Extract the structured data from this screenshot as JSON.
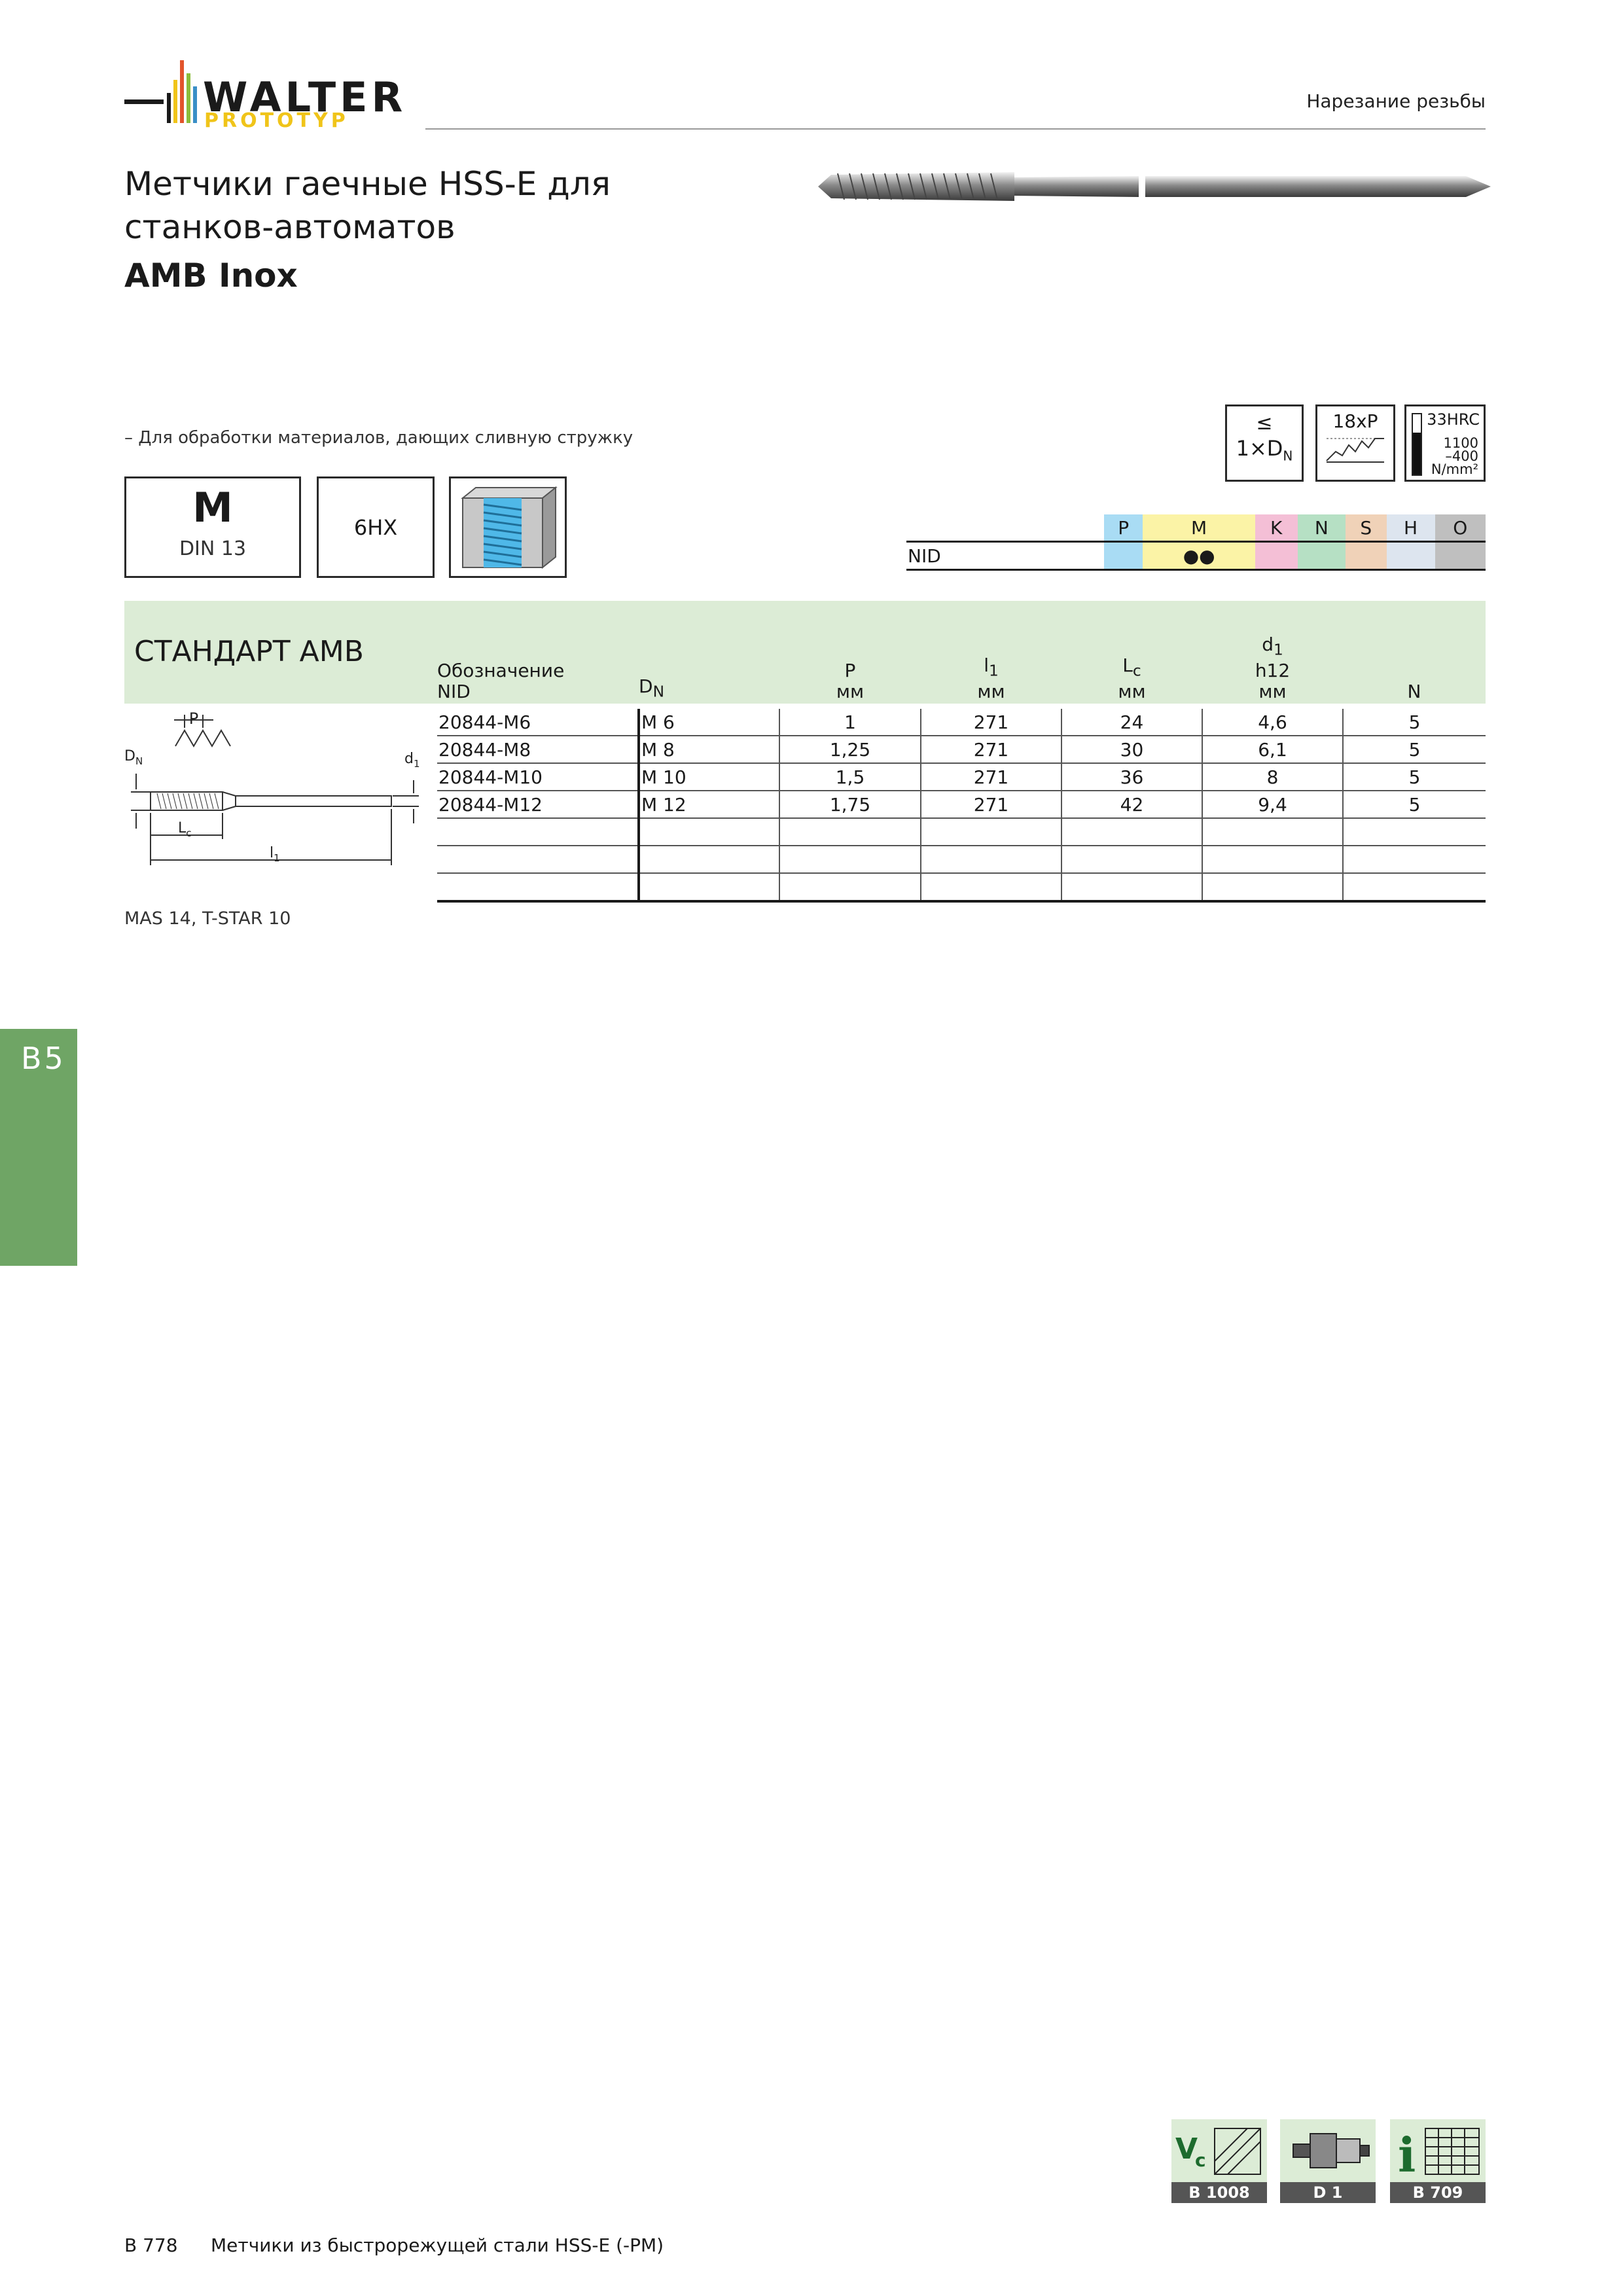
{
  "brand": {
    "name": "WALTER",
    "sub": "PROTOTYP",
    "stripe_colors": [
      "#1a1a1a",
      "#f0c419",
      "#e2542b",
      "#8bbd3b",
      "#3a8fc7"
    ],
    "accent_yellow": "#f0c419"
  },
  "header": {
    "section": "Нарезание резьбы"
  },
  "title": {
    "line1": "Метчики гаечные HSS-E для",
    "line2": "станков-автоматов",
    "product": "AMB Inox"
  },
  "feature": "– Для обработки материалов, дающих сливную стружку",
  "icons": {
    "depth": {
      "line1": "≤",
      "line2": "1×D",
      "sub": "N"
    },
    "chamfer": {
      "label": "18xP"
    },
    "hardness": {
      "hrc": "33HRC",
      "n1": "1100",
      "n2": "–400",
      "n3": "N/mm²"
    }
  },
  "spec": {
    "thread": "M",
    "standard": "DIN 13",
    "tolerance": "6HX"
  },
  "materials": {
    "row_label": "NID",
    "groups": [
      {
        "code": "P",
        "color": "#a9dcf4",
        "mark": ""
      },
      {
        "code": "M",
        "color": "#fbf3a6",
        "mark": "●●"
      },
      {
        "code": "K",
        "color": "#f4bfd6",
        "mark": ""
      },
      {
        "code": "N",
        "color": "#b6e0c4",
        "mark": ""
      },
      {
        "code": "S",
        "color": "#f0d2b8",
        "mark": ""
      },
      {
        "code": "H",
        "color": "#dde5ef",
        "mark": ""
      },
      {
        "code": "O",
        "color": "#bfbfbf",
        "mark": ""
      }
    ]
  },
  "table": {
    "band_title": "СТАНДАРТ AMB",
    "band_color": "#dcecd6",
    "headers": {
      "designation": "Обозначение",
      "designation2": "NID",
      "dn": "D",
      "dn_sub": "N",
      "p": "P",
      "p_unit": "мм",
      "l1": "l",
      "l1_sub": "1",
      "l1_unit": "мм",
      "lc": "L",
      "lc_sub": "c",
      "lc_unit": "мм",
      "d1": "d",
      "d1_sub": "1",
      "d1_tol": "h12",
      "d1_unit": "мм",
      "n": "N"
    },
    "rows": [
      {
        "id": "20844-M6",
        "dn": "M 6",
        "p": "1",
        "l1": "271",
        "lc": "24",
        "d1": "4,6",
        "n": "5"
      },
      {
        "id": "20844-M8",
        "dn": "M 8",
        "p": "1,25",
        "l1": "271",
        "lc": "30",
        "d1": "6,1",
        "n": "5"
      },
      {
        "id": "20844-M10",
        "dn": "M 10",
        "p": "1,5",
        "l1": "271",
        "lc": "36",
        "d1": "8",
        "n": "5"
      },
      {
        "id": "20844-M12",
        "dn": "M 12",
        "p": "1,75",
        "l1": "271",
        "lc": "42",
        "d1": "9,4",
        "n": "5"
      }
    ]
  },
  "drawing": {
    "p": "P",
    "dn": "D",
    "dn_sub": "N",
    "d1": "d",
    "d1_sub": "1",
    "lc": "L",
    "lc_sub": "c",
    "l1": "l",
    "l1_sub": "1"
  },
  "footnote": "MAS 14, T-STAR 10",
  "side_tab": "B5",
  "side_tab_color": "#6fa565",
  "refs": [
    {
      "label": "B 1008",
      "icon": "cutting-speed-icon"
    },
    {
      "label": "D 1",
      "icon": "tool-holder-icon"
    },
    {
      "label": "B 709",
      "icon": "info-table-icon"
    }
  ],
  "footer": {
    "page": "B 778",
    "text": "Метчики из быстрорежущей стали HSS-E (-PM)"
  }
}
